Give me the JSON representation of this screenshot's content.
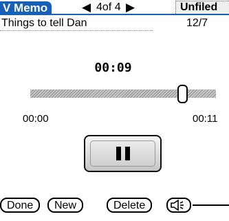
{
  "titlebar": {
    "app_title": "V Memo",
    "record_position": "4of 4",
    "category": "Unfiled"
  },
  "memo": {
    "title": "Things to tell Dan",
    "date": "12/7"
  },
  "player": {
    "elapsed": "00:09",
    "start_time": "00:00",
    "end_time": "00:11",
    "progress": 0.82
  },
  "buttons": {
    "done": "Done",
    "new": "New",
    "delete": "Delete"
  },
  "icons": {
    "prev": "triangle-left-icon",
    "next": "triangle-right-icon",
    "pause": "pause-icon",
    "volume": "speaker-icon"
  }
}
